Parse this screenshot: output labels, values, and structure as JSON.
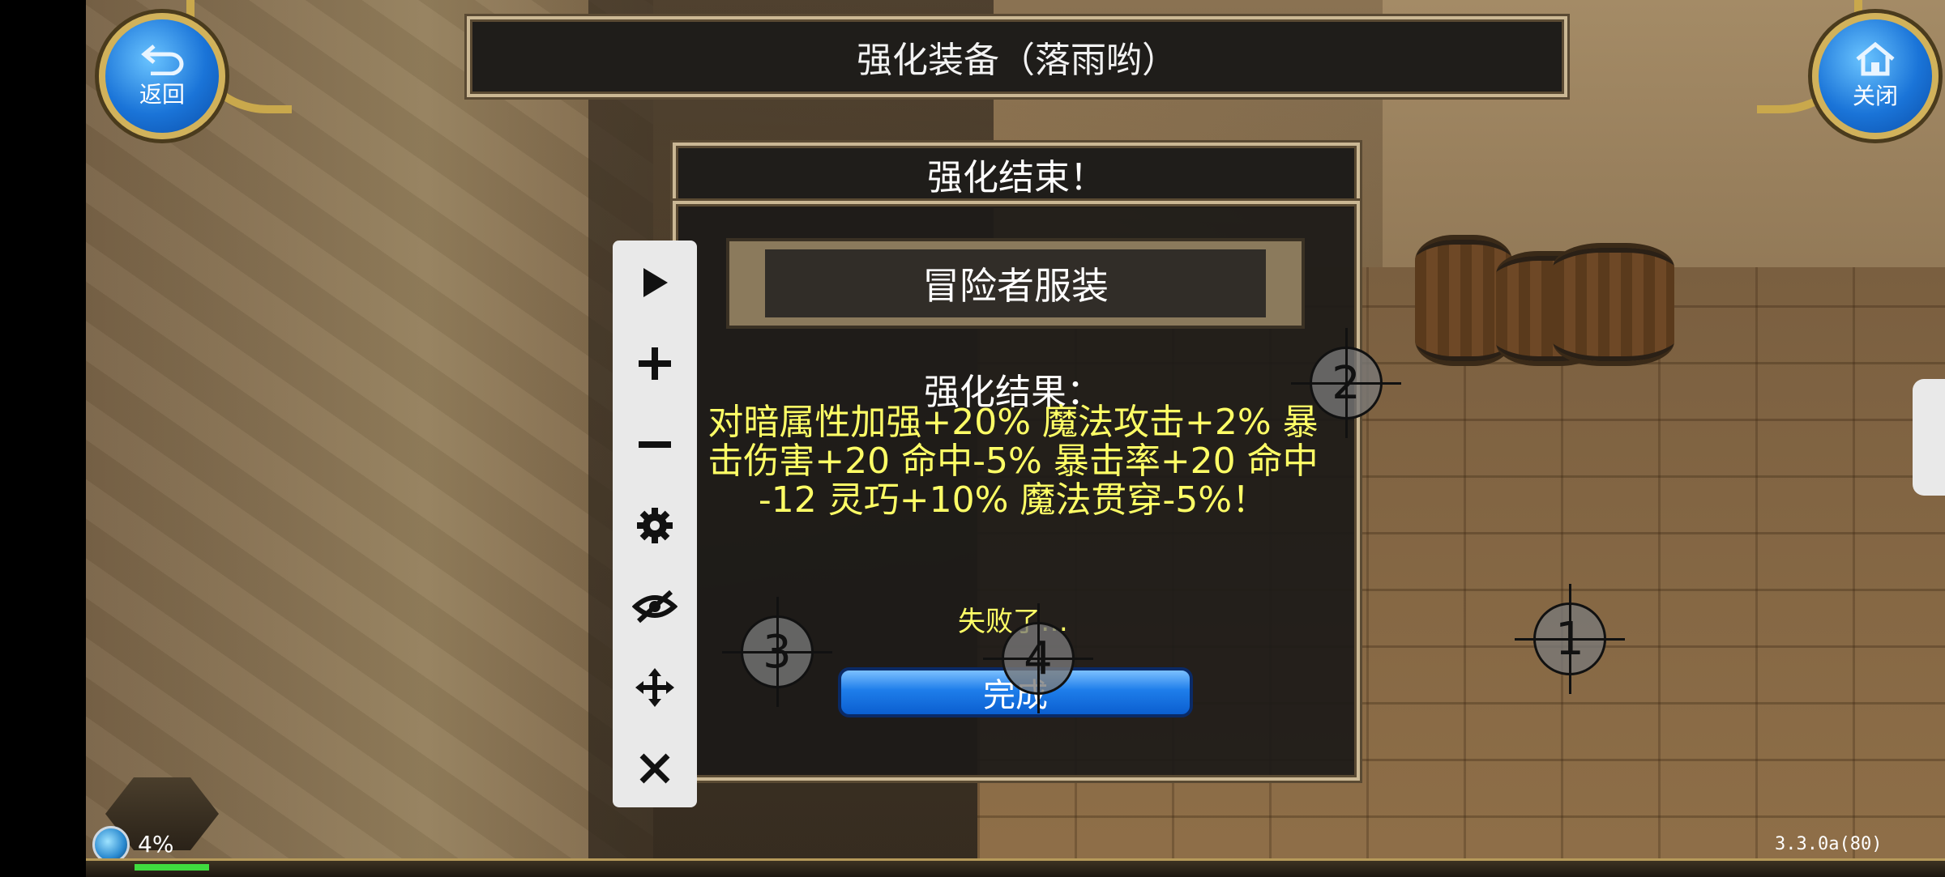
{
  "header": {
    "title": "强化装备（落雨哟）",
    "back_label": "返回",
    "close_label": "关闭"
  },
  "dialog": {
    "title": "强化结束！",
    "item_name": "冒险者服装",
    "result_label": "强化结果：",
    "result_lines": [
      "对暗属性加强+20% 魔法攻击+2% 暴",
      "击伤害+20 命中-5% 暴击率+20 命中",
      "-12 灵巧+10% 魔法贯穿-5%！"
    ],
    "fail_text": "失败了…",
    "done_label": "完成"
  },
  "toolbar": {
    "tools": [
      "play-icon",
      "plus-icon",
      "minus-icon",
      "gear-icon",
      "eye-off-icon",
      "move-icon",
      "close-icon"
    ]
  },
  "markers": [
    "1",
    "2",
    "3",
    "4"
  ],
  "hud": {
    "exp_percent": "4%",
    "version": "3.3.0a(80)"
  },
  "colors": {
    "accent_blue": "#1e7dea",
    "result_text": "#ffff66",
    "frame_gold": "#cbb894"
  }
}
